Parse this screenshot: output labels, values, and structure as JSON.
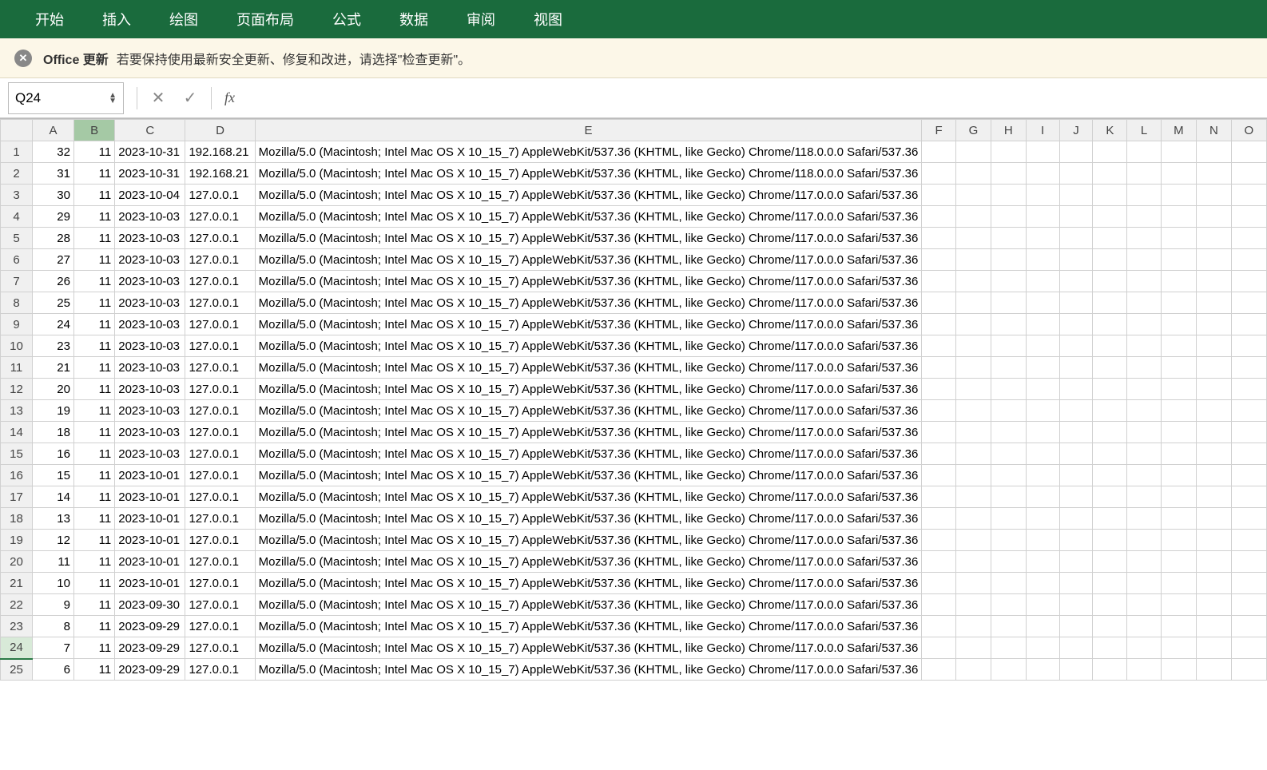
{
  "ribbon": {
    "tabs": [
      "开始",
      "插入",
      "绘图",
      "页面布局",
      "公式",
      "数据",
      "审阅",
      "视图"
    ]
  },
  "banner": {
    "title": "Office 更新",
    "message": "若要保持使用最新安全更新、修复和改进，请选择\"检查更新\"。"
  },
  "formula_bar": {
    "cell_ref": "Q24",
    "fx_label": "fx",
    "value": ""
  },
  "columns": [
    "A",
    "B",
    "C",
    "D",
    "E",
    "F",
    "G",
    "H",
    "I",
    "J",
    "K",
    "L",
    "M",
    "N",
    "O"
  ],
  "selected_column": "B",
  "selected_row": 24,
  "ua_118": "Mozilla/5.0 (Macintosh; Intel Mac OS X 10_15_7) AppleWebKit/537.36 (KHTML, like Gecko) Chrome/118.0.0.0 Safari/537.36",
  "ua_117": "Mozilla/5.0 (Macintosh; Intel Mac OS X 10_15_7) AppleWebKit/537.36 (KHTML, like Gecko) Chrome/117.0.0.0 Safari/537.36",
  "rows": [
    {
      "A": 32,
      "B": 11,
      "C": "2023-10-31",
      "D": "192.168.21",
      "E": "ua_118"
    },
    {
      "A": 31,
      "B": 11,
      "C": "2023-10-31",
      "D": "192.168.21",
      "E": "ua_118"
    },
    {
      "A": 30,
      "B": 11,
      "C": "2023-10-04",
      "D": "127.0.0.1",
      "E": "ua_117"
    },
    {
      "A": 29,
      "B": 11,
      "C": "2023-10-03",
      "D": "127.0.0.1",
      "E": "ua_117"
    },
    {
      "A": 28,
      "B": 11,
      "C": "2023-10-03",
      "D": "127.0.0.1",
      "E": "ua_117"
    },
    {
      "A": 27,
      "B": 11,
      "C": "2023-10-03",
      "D": "127.0.0.1",
      "E": "ua_117"
    },
    {
      "A": 26,
      "B": 11,
      "C": "2023-10-03",
      "D": "127.0.0.1",
      "E": "ua_117"
    },
    {
      "A": 25,
      "B": 11,
      "C": "2023-10-03",
      "D": "127.0.0.1",
      "E": "ua_117"
    },
    {
      "A": 24,
      "B": 11,
      "C": "2023-10-03",
      "D": "127.0.0.1",
      "E": "ua_117"
    },
    {
      "A": 23,
      "B": 11,
      "C": "2023-10-03",
      "D": "127.0.0.1",
      "E": "ua_117"
    },
    {
      "A": 21,
      "B": 11,
      "C": "2023-10-03",
      "D": "127.0.0.1",
      "E": "ua_117"
    },
    {
      "A": 20,
      "B": 11,
      "C": "2023-10-03",
      "D": "127.0.0.1",
      "E": "ua_117"
    },
    {
      "A": 19,
      "B": 11,
      "C": "2023-10-03",
      "D": "127.0.0.1",
      "E": "ua_117"
    },
    {
      "A": 18,
      "B": 11,
      "C": "2023-10-03",
      "D": "127.0.0.1",
      "E": "ua_117"
    },
    {
      "A": 16,
      "B": 11,
      "C": "2023-10-03",
      "D": "127.0.0.1",
      "E": "ua_117"
    },
    {
      "A": 15,
      "B": 11,
      "C": "2023-10-01",
      "D": "127.0.0.1",
      "E": "ua_117"
    },
    {
      "A": 14,
      "B": 11,
      "C": "2023-10-01",
      "D": "127.0.0.1",
      "E": "ua_117"
    },
    {
      "A": 13,
      "B": 11,
      "C": "2023-10-01",
      "D": "127.0.0.1",
      "E": "ua_117"
    },
    {
      "A": 12,
      "B": 11,
      "C": "2023-10-01",
      "D": "127.0.0.1",
      "E": "ua_117"
    },
    {
      "A": 11,
      "B": 11,
      "C": "2023-10-01",
      "D": "127.0.0.1",
      "E": "ua_117"
    },
    {
      "A": 10,
      "B": 11,
      "C": "2023-10-01",
      "D": "127.0.0.1",
      "E": "ua_117"
    },
    {
      "A": 9,
      "B": 11,
      "C": "2023-09-30",
      "D": "127.0.0.1",
      "E": "ua_117"
    },
    {
      "A": 8,
      "B": 11,
      "C": "2023-09-29",
      "D": "127.0.0.1",
      "E": "ua_117"
    },
    {
      "A": 7,
      "B": 11,
      "C": "2023-09-29",
      "D": "127.0.0.1",
      "E": "ua_117"
    },
    {
      "A": 6,
      "B": 11,
      "C": "2023-09-29",
      "D": "127.0.0.1",
      "E": "ua_117"
    }
  ]
}
